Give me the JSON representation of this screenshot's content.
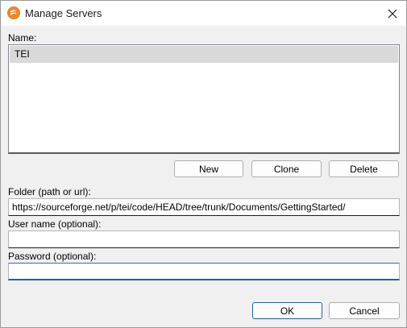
{
  "window": {
    "title": "Manage Servers",
    "close_glyph": "✕"
  },
  "icons": {
    "app": "oxygen-app-icon",
    "close": "close-icon"
  },
  "colors": {
    "app_icon": "#e8892b",
    "default_button_border": "#1f5fa8",
    "selected_row": "#d9d9d9"
  },
  "name_section": {
    "label": "Name:",
    "items": [
      {
        "label": "TEI",
        "selected": true
      }
    ]
  },
  "list_buttons": {
    "new": "New",
    "clone": "Clone",
    "delete": "Delete"
  },
  "folder": {
    "label": "Folder (path or url):",
    "value": "https://sourceforge.net/p/tei/code/HEAD/tree/trunk/Documents/GettingStarted/"
  },
  "username": {
    "label": "User name (optional):",
    "value": ""
  },
  "password": {
    "label": "Password (optional):",
    "value": ""
  },
  "dialog_buttons": {
    "ok": "OK",
    "cancel": "Cancel"
  }
}
